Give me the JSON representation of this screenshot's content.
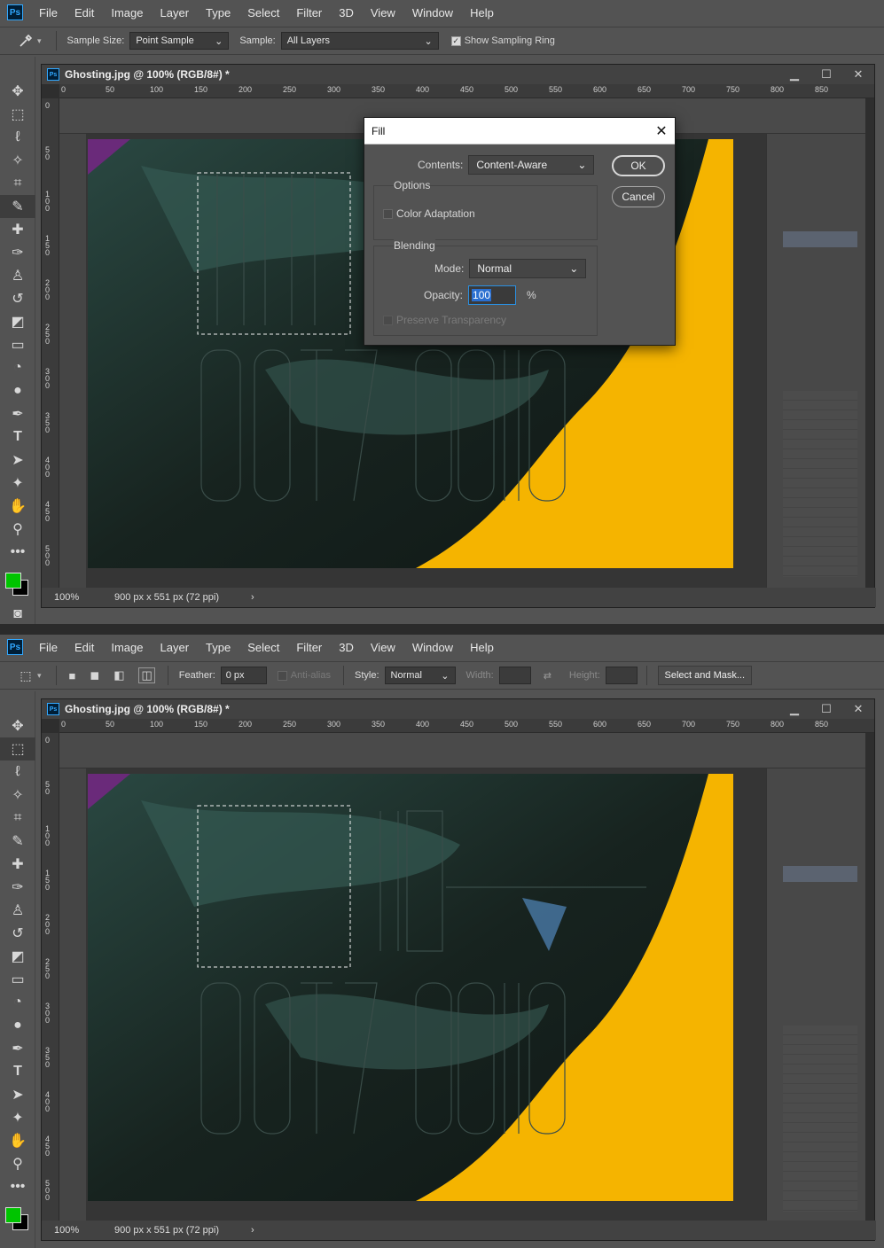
{
  "menu": [
    "File",
    "Edit",
    "Image",
    "Layer",
    "Type",
    "Select",
    "Filter",
    "3D",
    "View",
    "Window",
    "Help"
  ],
  "app_logo": "Ps",
  "top_options": {
    "sample_size_label": "Sample Size:",
    "sample_size_value": "Point Sample",
    "sample_label": "Sample:",
    "sample_value": "All Layers",
    "show_ring_label": "Show Sampling Ring"
  },
  "bottom_options": {
    "feather_label": "Feather:",
    "feather_value": "0 px",
    "antialias_label": "Anti-alias",
    "style_label": "Style:",
    "style_value": "Normal",
    "width_label": "Width:",
    "height_label": "Height:",
    "select_mask_label": "Select and Mask..."
  },
  "document": {
    "title": "Ghosting.jpg @ 100% (RGB/8#) *",
    "zoom": "100%",
    "dimensions": "900 px x 551 px (72 ppi)",
    "ruler_ticks": [
      "0",
      "50",
      "100",
      "150",
      "200",
      "250",
      "300",
      "350",
      "400",
      "450",
      "500",
      "550",
      "600",
      "650",
      "700",
      "750",
      "800",
      "850"
    ],
    "vruler_ticks": [
      "0",
      "5 0",
      "1 0 0",
      "1 5 0",
      "2 0 0",
      "2 5 0",
      "3 0 0",
      "3 5 0",
      "4 0 0",
      "4 5 0",
      "5 0 0"
    ]
  },
  "fill_dialog": {
    "title": "Fill",
    "contents_label": "Contents:",
    "contents_value": "Content-Aware",
    "options_label": "Options",
    "color_adaptation_label": "Color Adaptation",
    "blending_label": "Blending",
    "mode_label": "Mode:",
    "mode_value": "Normal",
    "opacity_label": "Opacity:",
    "opacity_value": "100",
    "opacity_unit": "%",
    "preserve_label": "Preserve Transparency",
    "ok_label": "OK",
    "cancel_label": "Cancel"
  },
  "colors": {
    "accent_yellow": "#f5b400",
    "foreground": "#00c400",
    "background": "#000000"
  }
}
